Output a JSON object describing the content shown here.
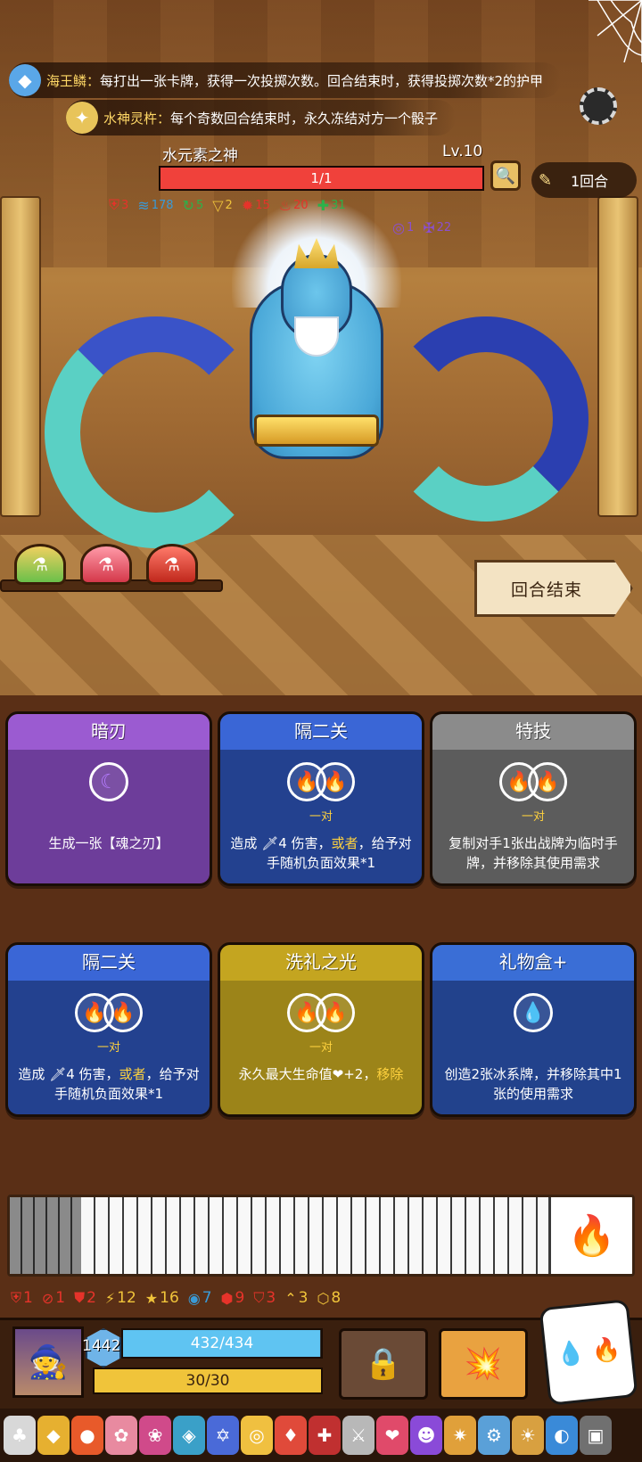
{
  "relics": [
    {
      "name": "海王鳞：",
      "desc": "每打出一张卡牌，获得一次投掷次数。回合结束时，获得投掷次数*2的护甲",
      "icon": "scale-icon"
    },
    {
      "name": "水神灵杵：",
      "desc": "每个奇数回合结束时，永久冻结对方一个骰子",
      "icon": "scepter-icon"
    }
  ],
  "enemy": {
    "name": "水元素之神",
    "level": "Lv.10",
    "hp_text": "1/1",
    "hp_fraction": 1.0,
    "statuses_row1": [
      {
        "icon": "shield-icon",
        "color": "#e6332a",
        "value": "3"
      },
      {
        "icon": "wind-icon",
        "color": "#3a9ad6",
        "value": "178"
      },
      {
        "icon": "cycle-icon",
        "color": "#2bb24a",
        "value": "5"
      },
      {
        "icon": "triangle-icon",
        "color": "#f0c43a",
        "value": "2"
      },
      {
        "icon": "rage-icon",
        "color": "#e6332a",
        "value": "15"
      },
      {
        "icon": "fire-icon",
        "color": "#e6332a",
        "value": "20"
      },
      {
        "icon": "regen-icon",
        "color": "#2bb24a",
        "value": "31"
      }
    ],
    "statuses_row2": [
      {
        "icon": "ring-icon",
        "color": "#8b4fd1",
        "value": "1"
      },
      {
        "icon": "sigil-icon",
        "color": "#8b4fd1",
        "value": "22"
      }
    ]
  },
  "turn": {
    "label": "1回合"
  },
  "end_turn_label": "回合结束",
  "cards": [
    {
      "title": "暗刃",
      "style": "purple",
      "cost": "moon",
      "pair": "",
      "text_parts": [
        "生成一张【魂之刃】"
      ]
    },
    {
      "title": "隔二关",
      "style": "blue",
      "cost": "fire-pair",
      "pair": "一对",
      "text_parts": [
        "造成 🗡4 伤害，",
        "或者",
        "，给予对手随机负面效果*1"
      ]
    },
    {
      "title": "特技",
      "style": "gray",
      "cost": "fire-pair",
      "pair": "一对",
      "text_parts": [
        "复制对手1张出战牌为临时手牌，并移除其使用需求"
      ]
    },
    {
      "title": "隔二关",
      "style": "blue",
      "cost": "fire-pair",
      "pair": "一对",
      "text_parts": [
        "造成 🗡4 伤害，",
        "或者",
        "，给予对手随机负面效果*1"
      ]
    },
    {
      "title": "洗礼之光",
      "style": "gold",
      "cost": "fire-pair",
      "pair": "一对",
      "text_parts": [
        "永久最大生命值❤+2，",
        "移除",
        ""
      ]
    },
    {
      "title": "礼物盒+",
      "style": "blue2",
      "cost": "water",
      "pair": "",
      "text_parts": [
        "创造2张冰系牌，并移除其中1张的使用需求"
      ]
    }
  ],
  "player_statuses": [
    {
      "icon": "shield-icon",
      "color": "#e6332a",
      "value": "1"
    },
    {
      "icon": "no-icon",
      "color": "#e6332a",
      "value": "1"
    },
    {
      "icon": "armor-icon",
      "color": "#e6332a",
      "value": "2"
    },
    {
      "icon": "lightning-icon",
      "color": "#f0c43a",
      "value": "12"
    },
    {
      "icon": "star-icon",
      "color": "#f0c43a",
      "value": "16"
    },
    {
      "icon": "swirl-icon",
      "color": "#3a9ad6",
      "value": "7"
    },
    {
      "icon": "badge-icon",
      "color": "#e6332a",
      "value": "9"
    },
    {
      "icon": "crest-icon",
      "color": "#e6332a",
      "value": "3"
    },
    {
      "icon": "chevron-icon",
      "color": "#f0c43a",
      "value": "3"
    },
    {
      "icon": "hexagon-icon",
      "color": "#f0c43a",
      "value": "8"
    }
  ],
  "player": {
    "armor": "1442",
    "hp_text": "432/434",
    "hp_fraction": 0.995,
    "energy_text": "30/30",
    "energy_fraction": 1.0
  },
  "colors": {
    "accent": "#f0413b",
    "hp": "#5fc4f2",
    "energy": "#f0c43a"
  }
}
